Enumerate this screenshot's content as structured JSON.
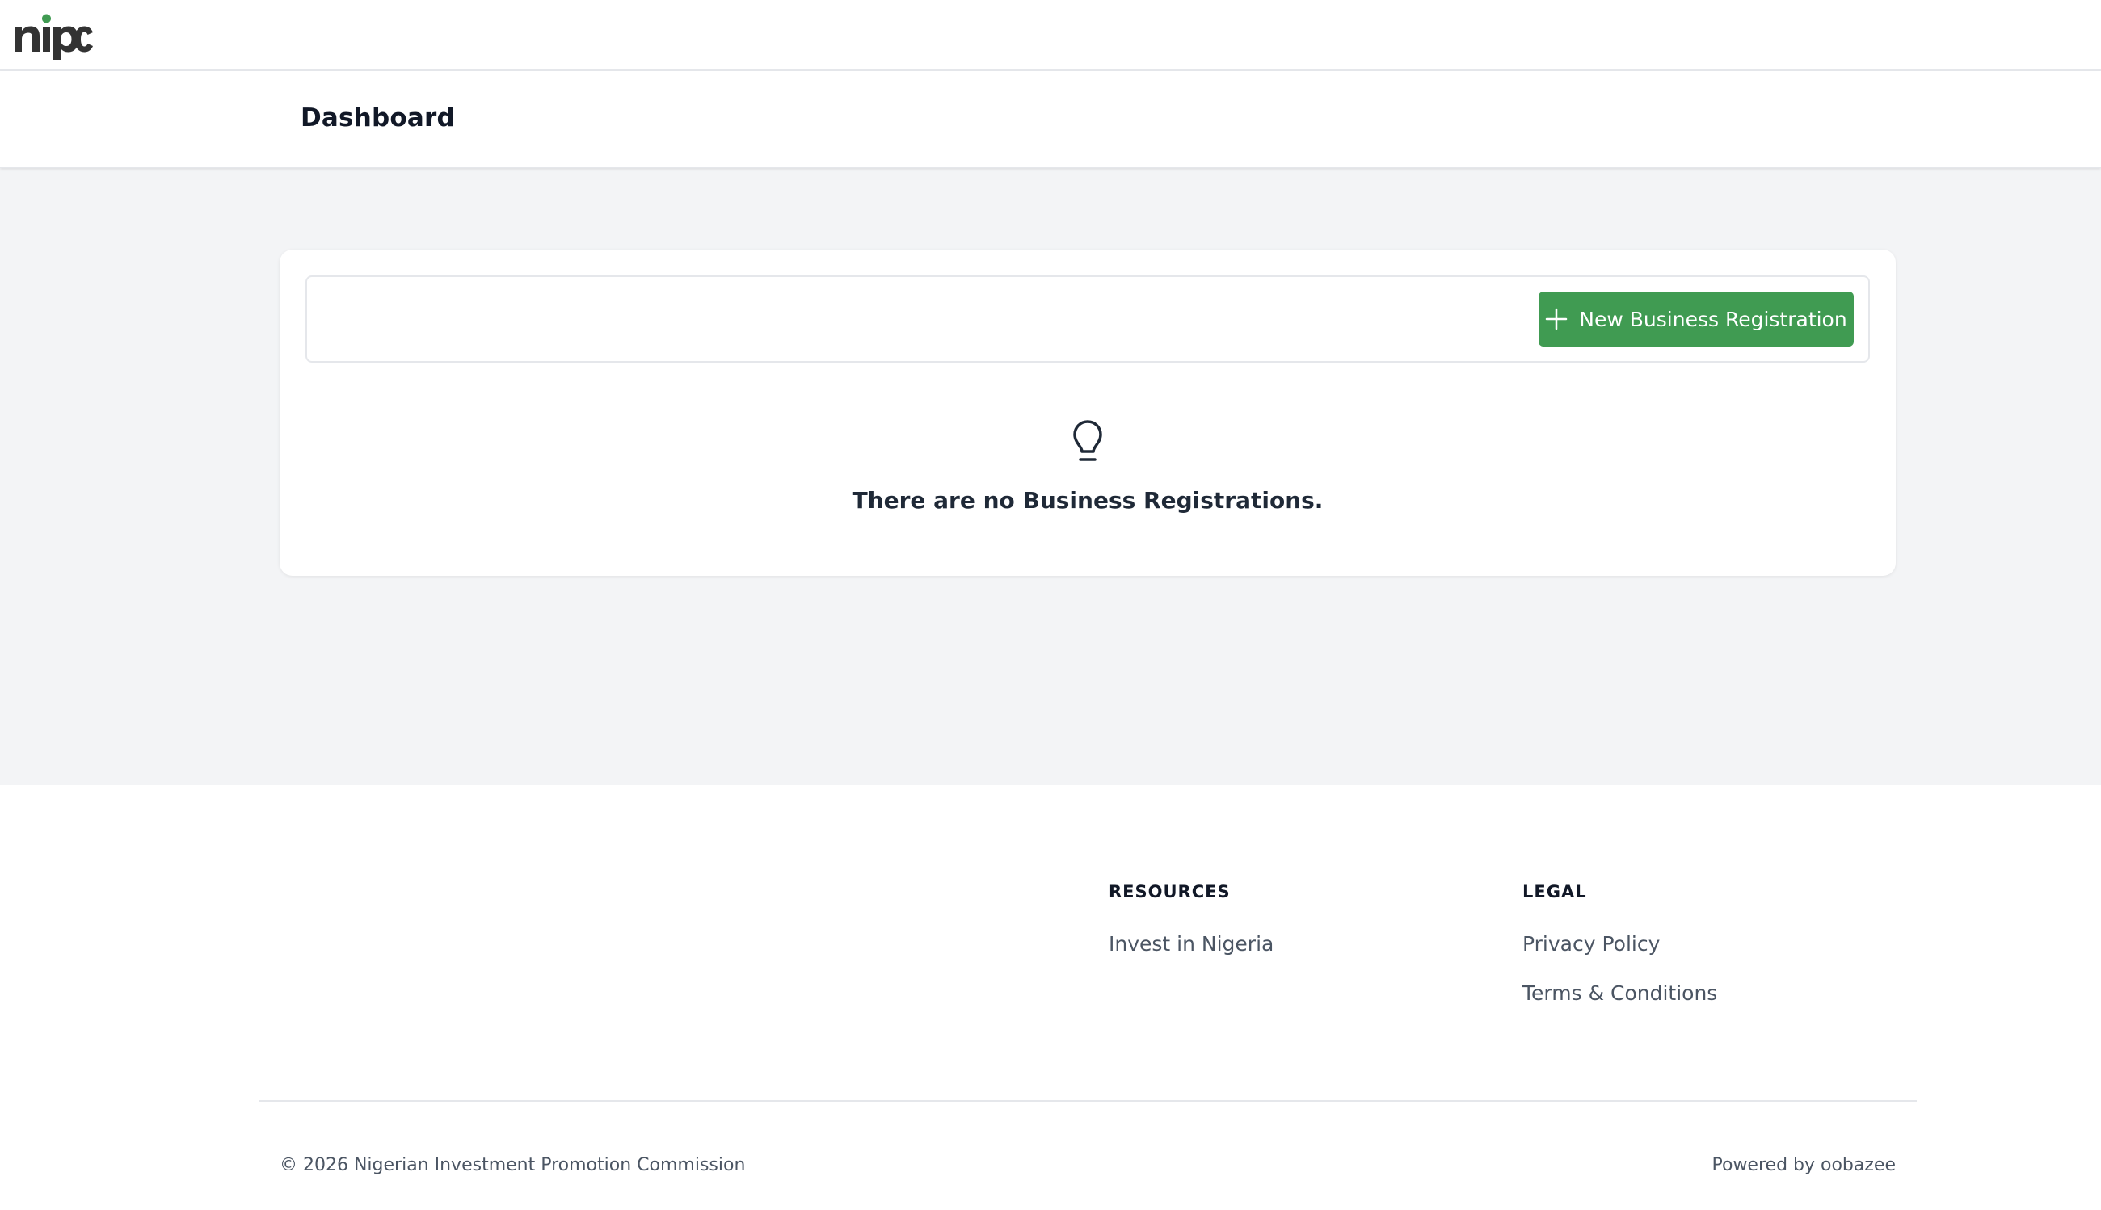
{
  "brand": {
    "logo_text": "nipc",
    "accent_color": "#409b52"
  },
  "header": {
    "title": "Dashboard"
  },
  "main": {
    "new_button_label": "New Business Registration",
    "new_button_icon": "plus-icon",
    "empty_icon": "lightbulb-icon",
    "empty_message": "There are no Business Registrations."
  },
  "footer": {
    "resources": {
      "heading": "RESOURCES",
      "links": [
        "Invest in Nigeria"
      ]
    },
    "legal": {
      "heading": "LEGAL",
      "links": [
        "Privacy Policy",
        "Terms & Conditions"
      ]
    },
    "copyright": "© 2026 Nigerian Investment Promotion Commission",
    "powered_by": "Powered by oobazee"
  }
}
